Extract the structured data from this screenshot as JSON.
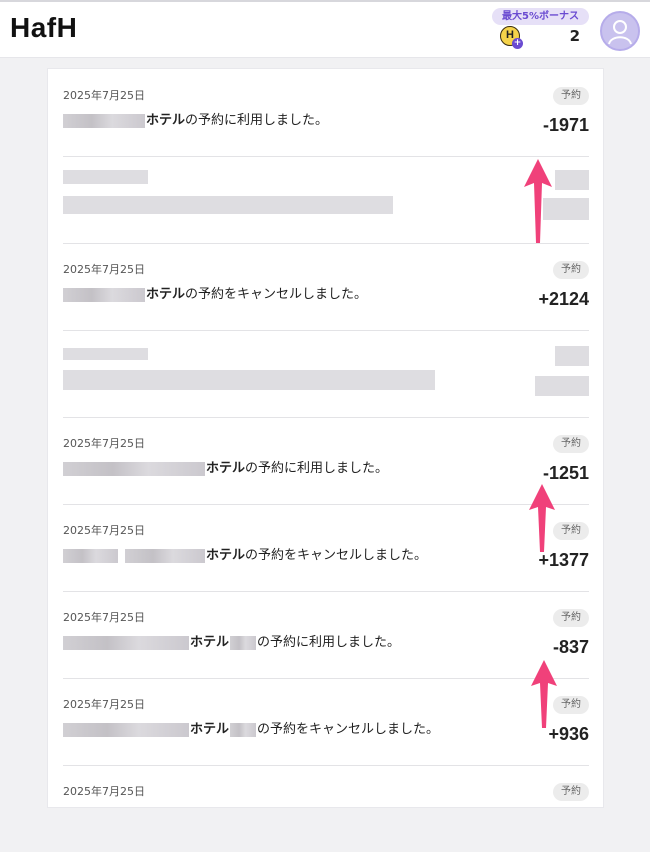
{
  "header": {
    "logo": "HafH",
    "bonus_badge": "最大5%ボーナス",
    "coin_symbol": "H",
    "coin_count": "2"
  },
  "transactions": [
    {
      "date": "2025年7月25日",
      "hotel_label": "ホテル",
      "action": "の予約に利用しました。",
      "tag": "予約",
      "amount": "-1971"
    },
    {
      "date": "",
      "hotel_label": "",
      "action": "",
      "tag": "",
      "amount": ""
    },
    {
      "date": "2025年7月25日",
      "hotel_label": "ホテル",
      "action": "の予約をキャンセルしました。",
      "tag": "予約",
      "amount": "+2124"
    },
    {
      "date": "",
      "hotel_label": "",
      "action": "",
      "tag": "",
      "amount": ""
    },
    {
      "date": "2025年7月25日",
      "hotel_label": "ホテル",
      "action": "の予約に利用しました。",
      "tag": "予約",
      "amount": "-1251"
    },
    {
      "date": "2025年7月25日",
      "hotel_label": "ホテル",
      "action": "の予約をキャンセルしました。",
      "tag": "予約",
      "amount": "+1377"
    },
    {
      "date": "2025年7月25日",
      "hotel_label": "ホテル",
      "action": "の予約に利用しました。",
      "tag": "予約",
      "amount": "-837"
    },
    {
      "date": "2025年7月25日",
      "hotel_label": "ホテル",
      "action": "の予約をキャンセルしました。",
      "tag": "予約",
      "amount": "+936"
    },
    {
      "date": "2025年7月25日",
      "hotel_label": "",
      "action": "",
      "tag": "予約",
      "amount": ""
    }
  ],
  "icons": {
    "coin": "hafh-coin-icon",
    "avatar": "user-avatar-icon",
    "annotation": "pink-up-arrow"
  },
  "colors": {
    "accent": "#6a4bd1",
    "arrow": "#f0417a",
    "badge_bg": "#e6e0f7"
  }
}
